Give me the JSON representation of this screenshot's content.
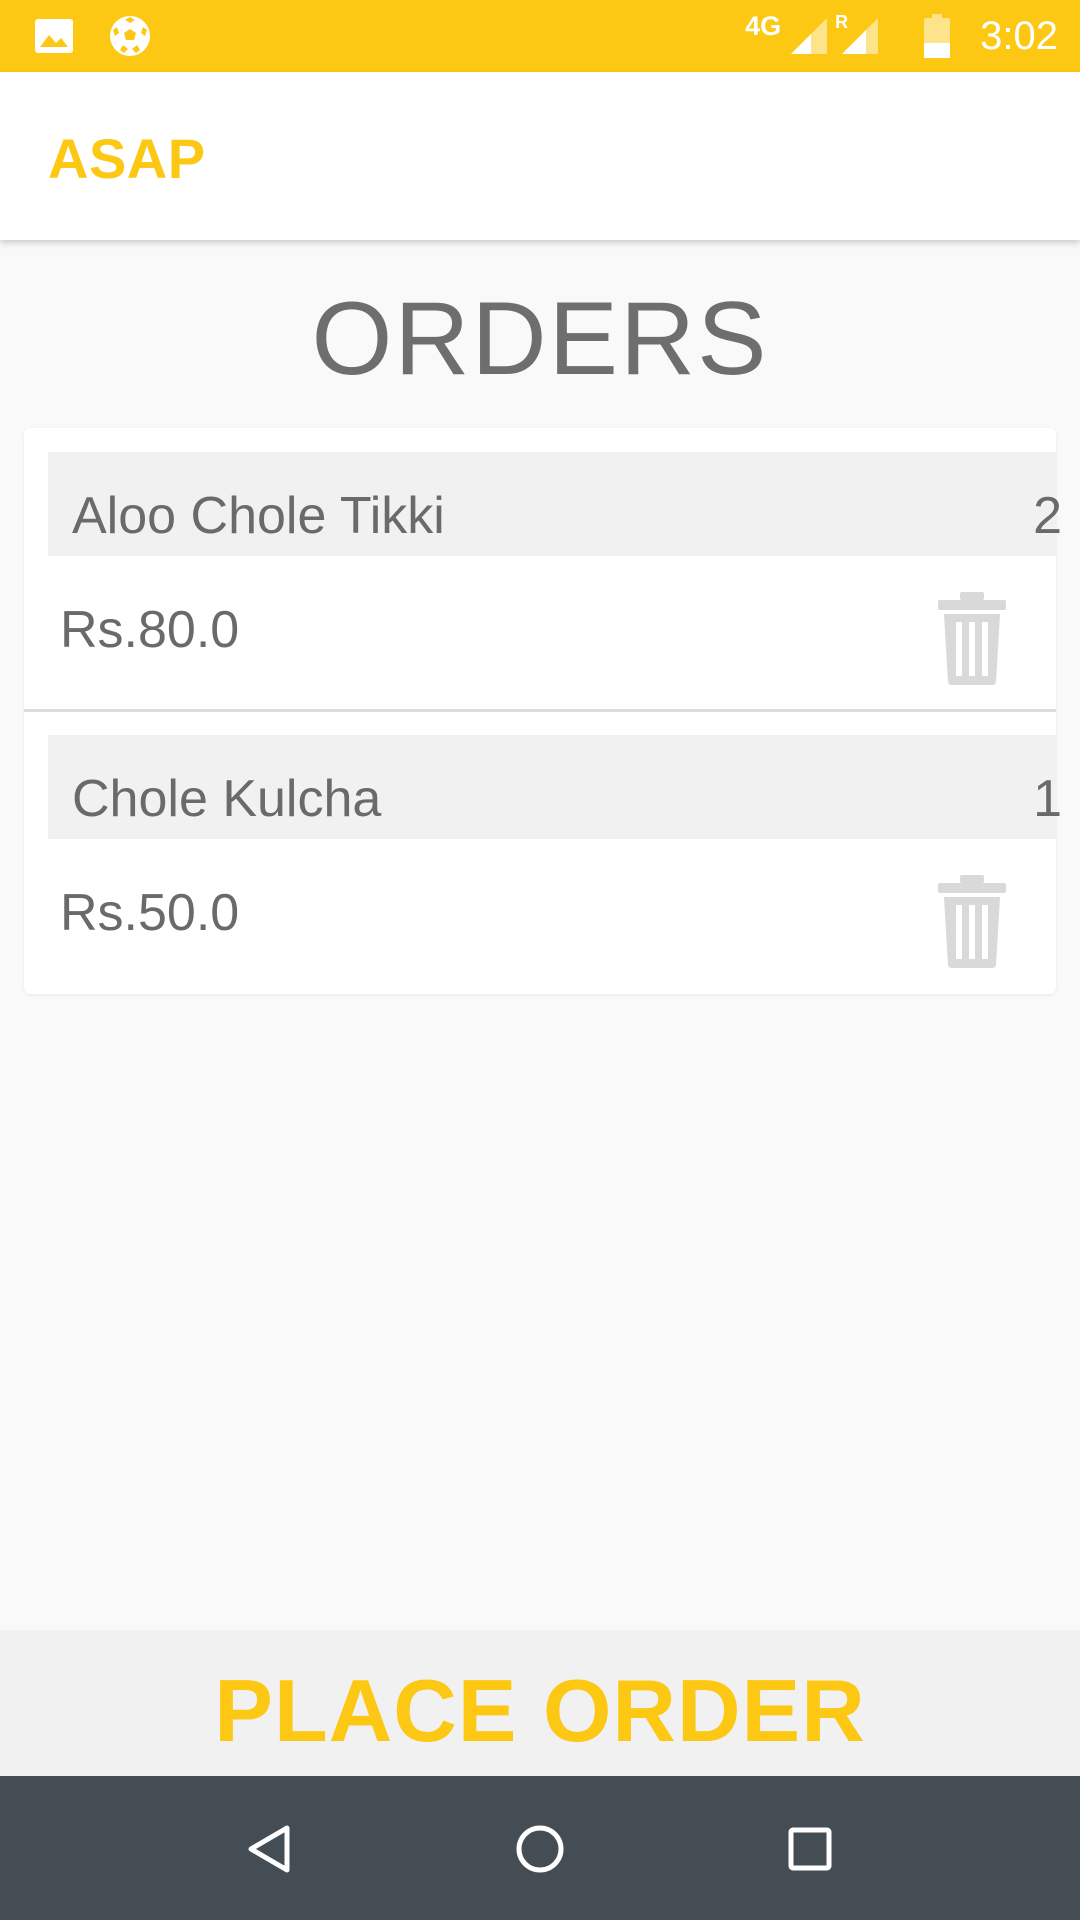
{
  "status_bar": {
    "network": "4G",
    "roaming": "R",
    "time": "3:02",
    "icons": [
      "image-icon",
      "soccer-ball-icon",
      "signal-icon",
      "signal-roaming-icon",
      "battery-icon"
    ]
  },
  "app_bar": {
    "title": "ASAP"
  },
  "page": {
    "heading": "ORDERS"
  },
  "orders": [
    {
      "name": "Aloo Chole Tikki",
      "qty": "2",
      "price": "Rs.80.0"
    },
    {
      "name": "Chole Kulcha",
      "qty": "1",
      "price": "Rs.50.0"
    }
  ],
  "place_order": {
    "label": "PLACE ORDER"
  },
  "nav_bar": {
    "icons": [
      "back-icon",
      "home-icon",
      "recents-icon"
    ]
  },
  "colors": {
    "accent": "#fcc814",
    "text": "#6a6a6a",
    "nav_bg": "#444c54"
  }
}
